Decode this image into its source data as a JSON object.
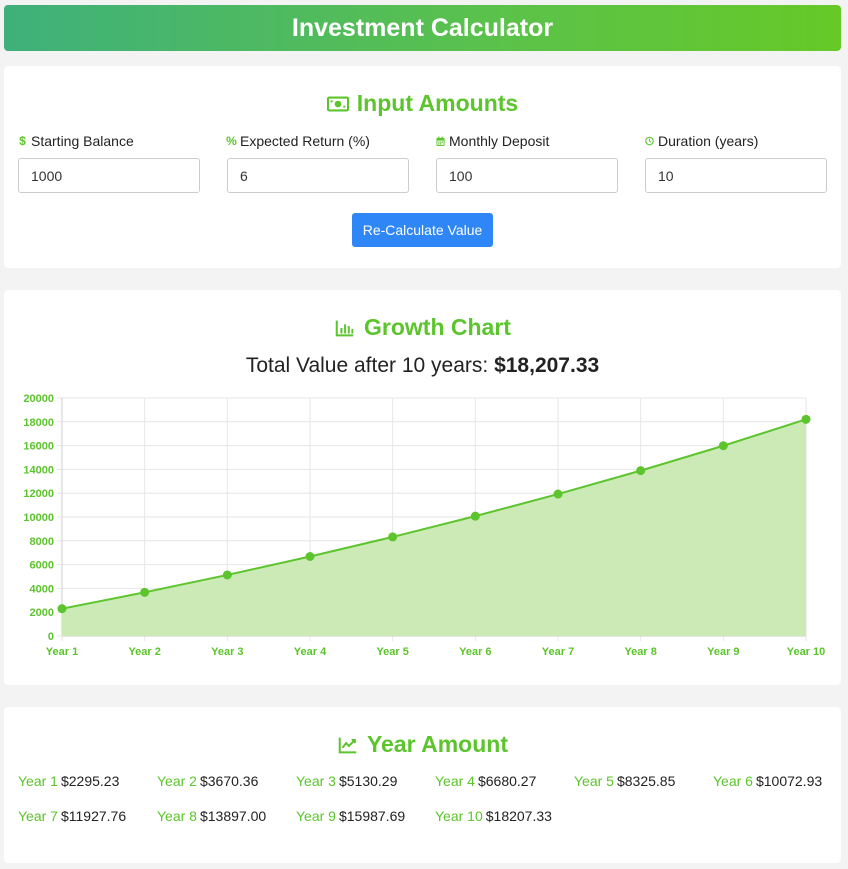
{
  "header": {
    "title": "Investment Calculator"
  },
  "input_section": {
    "title": "Input Amounts",
    "fields": [
      {
        "label": "Starting Balance",
        "value": "1000",
        "icon": "dollar-icon"
      },
      {
        "label": "Expected Return (%)",
        "value": "6",
        "icon": "percent-icon"
      },
      {
        "label": "Monthly Deposit",
        "value": "100",
        "icon": "calendar-icon"
      },
      {
        "label": "Duration (years)",
        "value": "10",
        "icon": "clock-icon"
      }
    ],
    "button_label": "Re-Calculate Value"
  },
  "chart_section": {
    "title": "Growth Chart",
    "total_prefix": "Total Value after 10 years:",
    "total_value": "$18,207.33"
  },
  "chart_data": {
    "type": "area",
    "categories": [
      "Year 1",
      "Year 2",
      "Year 3",
      "Year 4",
      "Year 5",
      "Year 6",
      "Year 7",
      "Year 8",
      "Year 9",
      "Year 10"
    ],
    "values": [
      2295.23,
      3670.36,
      5130.29,
      6680.27,
      8325.85,
      10072.93,
      11927.76,
      13897.0,
      15987.69,
      18207.33
    ],
    "yticks": [
      0,
      2000,
      4000,
      6000,
      8000,
      10000,
      12000,
      14000,
      16000,
      18000,
      20000
    ],
    "ylim": [
      0,
      20000
    ],
    "grid": true,
    "colors": {
      "line": "#5cc42c",
      "fill": "#cbeab6",
      "tick": "#5cc42c",
      "grid": "#e6e6e6"
    }
  },
  "year_section": {
    "title": "Year Amount",
    "items": [
      {
        "label": "Year 1",
        "amount": "$2295.23"
      },
      {
        "label": "Year 2",
        "amount": "$3670.36"
      },
      {
        "label": "Year 3",
        "amount": "$5130.29"
      },
      {
        "label": "Year 4",
        "amount": "$6680.27"
      },
      {
        "label": "Year 5",
        "amount": "$8325.85"
      },
      {
        "label": "Year 6",
        "amount": "$10072.93"
      },
      {
        "label": "Year 7",
        "amount": "$11927.76"
      },
      {
        "label": "Year 8",
        "amount": "$13897.00"
      },
      {
        "label": "Year 9",
        "amount": "$15987.69"
      },
      {
        "label": "Year 10",
        "amount": "$18207.33"
      }
    ]
  },
  "colors": {
    "accent": "#5cc42c",
    "button": "#2f86f6"
  }
}
